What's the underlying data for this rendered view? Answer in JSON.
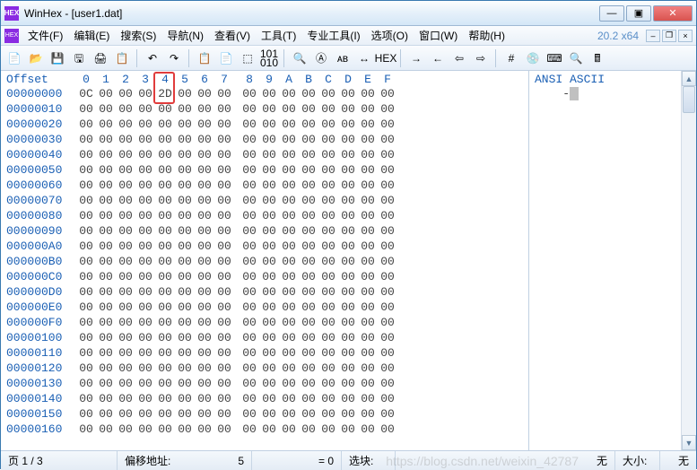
{
  "window": {
    "title": "WinHex - [user1.dat]",
    "app_icon_text": "HEX",
    "buttons": {
      "min": "—",
      "max": "▣",
      "close": "✕"
    }
  },
  "menu": {
    "icon_text": "HEX",
    "items": [
      {
        "label": "文件(F)",
        "key": "F"
      },
      {
        "label": "编辑(E)",
        "key": "E"
      },
      {
        "label": "搜索(S)",
        "key": "S"
      },
      {
        "label": "导航(N)",
        "key": "N"
      },
      {
        "label": "查看(V)",
        "key": "V"
      },
      {
        "label": "工具(T)",
        "key": "T"
      },
      {
        "label": "专业工具(I)",
        "key": "I"
      },
      {
        "label": "选项(O)",
        "key": "O"
      },
      {
        "label": "窗口(W)",
        "key": "W"
      },
      {
        "label": "帮助(H)",
        "key": "H"
      }
    ],
    "version": "20.2 x64",
    "mdi": {
      "min": "‒",
      "restore": "❐",
      "close": "×"
    }
  },
  "toolbar_icons": [
    "new-file",
    "open-file",
    "save",
    "save-alt",
    "print",
    "document",
    "|",
    "undo",
    "redo",
    "|",
    "copy",
    "paste",
    "paste-hex",
    "binary-insert",
    "|",
    "find",
    "find-hex",
    "find-text",
    "replace",
    "goto",
    "|",
    "back",
    "forward",
    "nav-back",
    "nav-forward",
    "|",
    "hash",
    "disk",
    "keyboard",
    "zoom",
    "calculator"
  ],
  "toolbar_glyphs": {
    "new-file": "📄",
    "open-file": "📂",
    "save": "💾",
    "save-alt": "🖫",
    "print": "🖨",
    "document": "📋",
    "undo": "↶",
    "redo": "↷",
    "copy": "📋",
    "paste": "📄",
    "paste-hex": "⬚",
    "binary-insert": "101\n010",
    "find": "🔍",
    "find-hex": "Ⓐ",
    "find-text": "ᴀʙ",
    "replace": "↔",
    "goto": "HEX",
    "back": "→",
    "forward": "←",
    "nav-back": "⇦",
    "nav-forward": "⇨",
    "hash": "#",
    "disk": "💿",
    "keyboard": "⌨",
    "zoom": "🔍",
    "calculator": "🖩"
  },
  "hex": {
    "offset_header": "Offset",
    "columns": [
      "0",
      "1",
      "2",
      "3",
      "4",
      "5",
      "6",
      "7",
      "8",
      "9",
      "A",
      "B",
      "C",
      "D",
      "E",
      "F"
    ],
    "rows": [
      {
        "offset": "00000000",
        "bytes": [
          "0C",
          "00",
          "00",
          "00",
          "2D",
          "00",
          "00",
          "00",
          "00",
          "00",
          "00",
          "00",
          "00",
          "00",
          "00",
          "00"
        ]
      },
      {
        "offset": "00000010",
        "bytes": [
          "00",
          "00",
          "00",
          "00",
          "00",
          "00",
          "00",
          "00",
          "00",
          "00",
          "00",
          "00",
          "00",
          "00",
          "00",
          "00"
        ]
      },
      {
        "offset": "00000020",
        "bytes": [
          "00",
          "00",
          "00",
          "00",
          "00",
          "00",
          "00",
          "00",
          "00",
          "00",
          "00",
          "00",
          "00",
          "00",
          "00",
          "00"
        ]
      },
      {
        "offset": "00000030",
        "bytes": [
          "00",
          "00",
          "00",
          "00",
          "00",
          "00",
          "00",
          "00",
          "00",
          "00",
          "00",
          "00",
          "00",
          "00",
          "00",
          "00"
        ]
      },
      {
        "offset": "00000040",
        "bytes": [
          "00",
          "00",
          "00",
          "00",
          "00",
          "00",
          "00",
          "00",
          "00",
          "00",
          "00",
          "00",
          "00",
          "00",
          "00",
          "00"
        ]
      },
      {
        "offset": "00000050",
        "bytes": [
          "00",
          "00",
          "00",
          "00",
          "00",
          "00",
          "00",
          "00",
          "00",
          "00",
          "00",
          "00",
          "00",
          "00",
          "00",
          "00"
        ]
      },
      {
        "offset": "00000060",
        "bytes": [
          "00",
          "00",
          "00",
          "00",
          "00",
          "00",
          "00",
          "00",
          "00",
          "00",
          "00",
          "00",
          "00",
          "00",
          "00",
          "00"
        ]
      },
      {
        "offset": "00000070",
        "bytes": [
          "00",
          "00",
          "00",
          "00",
          "00",
          "00",
          "00",
          "00",
          "00",
          "00",
          "00",
          "00",
          "00",
          "00",
          "00",
          "00"
        ]
      },
      {
        "offset": "00000080",
        "bytes": [
          "00",
          "00",
          "00",
          "00",
          "00",
          "00",
          "00",
          "00",
          "00",
          "00",
          "00",
          "00",
          "00",
          "00",
          "00",
          "00"
        ]
      },
      {
        "offset": "00000090",
        "bytes": [
          "00",
          "00",
          "00",
          "00",
          "00",
          "00",
          "00",
          "00",
          "00",
          "00",
          "00",
          "00",
          "00",
          "00",
          "00",
          "00"
        ]
      },
      {
        "offset": "000000A0",
        "bytes": [
          "00",
          "00",
          "00",
          "00",
          "00",
          "00",
          "00",
          "00",
          "00",
          "00",
          "00",
          "00",
          "00",
          "00",
          "00",
          "00"
        ]
      },
      {
        "offset": "000000B0",
        "bytes": [
          "00",
          "00",
          "00",
          "00",
          "00",
          "00",
          "00",
          "00",
          "00",
          "00",
          "00",
          "00",
          "00",
          "00",
          "00",
          "00"
        ]
      },
      {
        "offset": "000000C0",
        "bytes": [
          "00",
          "00",
          "00",
          "00",
          "00",
          "00",
          "00",
          "00",
          "00",
          "00",
          "00",
          "00",
          "00",
          "00",
          "00",
          "00"
        ]
      },
      {
        "offset": "000000D0",
        "bytes": [
          "00",
          "00",
          "00",
          "00",
          "00",
          "00",
          "00",
          "00",
          "00",
          "00",
          "00",
          "00",
          "00",
          "00",
          "00",
          "00"
        ]
      },
      {
        "offset": "000000E0",
        "bytes": [
          "00",
          "00",
          "00",
          "00",
          "00",
          "00",
          "00",
          "00",
          "00",
          "00",
          "00",
          "00",
          "00",
          "00",
          "00",
          "00"
        ]
      },
      {
        "offset": "000000F0",
        "bytes": [
          "00",
          "00",
          "00",
          "00",
          "00",
          "00",
          "00",
          "00",
          "00",
          "00",
          "00",
          "00",
          "00",
          "00",
          "00",
          "00"
        ]
      },
      {
        "offset": "00000100",
        "bytes": [
          "00",
          "00",
          "00",
          "00",
          "00",
          "00",
          "00",
          "00",
          "00",
          "00",
          "00",
          "00",
          "00",
          "00",
          "00",
          "00"
        ]
      },
      {
        "offset": "00000110",
        "bytes": [
          "00",
          "00",
          "00",
          "00",
          "00",
          "00",
          "00",
          "00",
          "00",
          "00",
          "00",
          "00",
          "00",
          "00",
          "00",
          "00"
        ]
      },
      {
        "offset": "00000120",
        "bytes": [
          "00",
          "00",
          "00",
          "00",
          "00",
          "00",
          "00",
          "00",
          "00",
          "00",
          "00",
          "00",
          "00",
          "00",
          "00",
          "00"
        ]
      },
      {
        "offset": "00000130",
        "bytes": [
          "00",
          "00",
          "00",
          "00",
          "00",
          "00",
          "00",
          "00",
          "00",
          "00",
          "00",
          "00",
          "00",
          "00",
          "00",
          "00"
        ]
      },
      {
        "offset": "00000140",
        "bytes": [
          "00",
          "00",
          "00",
          "00",
          "00",
          "00",
          "00",
          "00",
          "00",
          "00",
          "00",
          "00",
          "00",
          "00",
          "00",
          "00"
        ]
      },
      {
        "offset": "00000150",
        "bytes": [
          "00",
          "00",
          "00",
          "00",
          "00",
          "00",
          "00",
          "00",
          "00",
          "00",
          "00",
          "00",
          "00",
          "00",
          "00",
          "00"
        ]
      },
      {
        "offset": "00000160",
        "bytes": [
          "00",
          "00",
          "00",
          "00",
          "00",
          "00",
          "00",
          "00",
          "00",
          "00",
          "00",
          "00",
          "00",
          "00",
          "00",
          "00"
        ]
      }
    ],
    "highlight": {
      "row": 0,
      "col": 4,
      "header": true
    }
  },
  "ascii": {
    "header": "ANSI ASCII",
    "lines": [
      "    -"
    ],
    "cursor_visible": true
  },
  "status": {
    "page": "页 1 / 3",
    "offset_label": "偏移地址:",
    "offset_value": "5",
    "value_label": "= 0",
    "selection_label": "选块:",
    "selection_value": "无",
    "size_label": "大小:",
    "size_value": "无"
  },
  "watermark": "https://blog.csdn.net/weixin_42787"
}
